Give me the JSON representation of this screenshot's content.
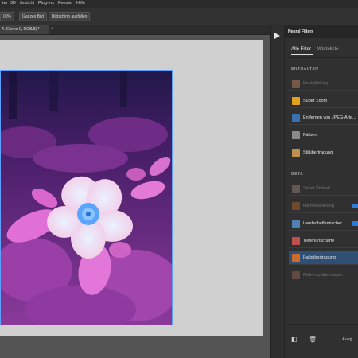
{
  "menubar": {
    "items": [
      "ter",
      "3D",
      "Ansicht",
      "Plug-ins",
      "Fenster",
      "Hilfe"
    ]
  },
  "options": {
    "zoom": "00%",
    "fit_screen": "Ganzes Bild",
    "fill_screen": "Bildschirm ausfüllen"
  },
  "document": {
    "tab_title": "A (Ebene 0, RGB/8) *",
    "close_glyph": "×"
  },
  "panel": {
    "title": "Neural Filters",
    "tabs": [
      "Alle Filter",
      "Warteliste"
    ],
    "sections": {
      "included": "ENTHALTEN",
      "beta": "BETA"
    },
    "included_filters": [
      {
        "label": "Hautglättung",
        "enabled": false,
        "thumb_color": "#b07a58"
      },
      {
        "label": "Super Zoom",
        "enabled": true,
        "thumb_color": "#e0a020"
      },
      {
        "label": "Entfernen von JPEG-Arte...",
        "enabled": true,
        "thumb_color": "#3a6fb0"
      },
      {
        "label": "Färben",
        "enabled": true,
        "thumb_color": "#8a8a8a"
      },
      {
        "label": "Stilübertragung",
        "enabled": true,
        "thumb_color": "#c09050"
      }
    ],
    "beta_filters": [
      {
        "label": "Smart Portrait",
        "enabled": false,
        "badge": false,
        "selected": false,
        "thumb_color": "#8a7a70"
      },
      {
        "label": "Harmonisierung",
        "enabled": false,
        "badge": true,
        "selected": false,
        "thumb_color": "#a06030"
      },
      {
        "label": "Landschaftsmischer",
        "enabled": true,
        "badge": true,
        "selected": false,
        "thumb_color": "#5080b0"
      },
      {
        "label": "Tiefenunschärfe",
        "enabled": true,
        "badge": false,
        "selected": false,
        "thumb_color": "#c05050"
      },
      {
        "label": "Farbübertragung",
        "enabled": true,
        "badge": false,
        "selected": true,
        "thumb_color": "#d06a2a"
      },
      {
        "label": "Make-up übertragen",
        "enabled": false,
        "badge": false,
        "selected": false,
        "thumb_color": "#8a6050"
      }
    ],
    "bottom": {
      "output_label": "Ausg"
    }
  },
  "colors": {
    "accent": "#2c7cd8",
    "selection": "#2f4f75",
    "photo_border": "#5da1ff"
  }
}
